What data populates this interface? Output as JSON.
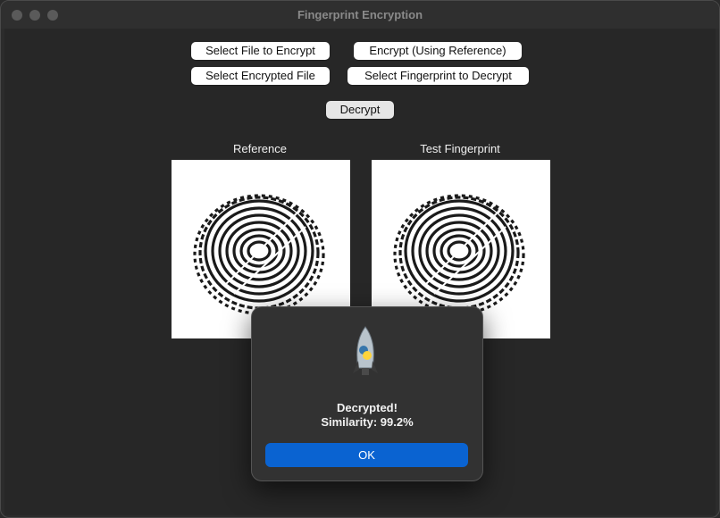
{
  "window": {
    "title": "Fingerprint Encryption"
  },
  "toolbar": {
    "select_file_label": "Select File to Encrypt",
    "encrypt_label": "Encrypt (Using Reference)",
    "select_encrypted_label": "Select Encrypted File",
    "select_fingerprint_label": "Select Fingerprint to Decrypt",
    "decrypt_label": "Decrypt"
  },
  "panels": {
    "reference_label": "Reference",
    "test_label": "Test Fingerprint"
  },
  "dialog": {
    "icon": "python-rocket-icon",
    "line1": "Decrypted!",
    "line2": "Similarity: 99.2%",
    "ok_label": "OK"
  },
  "colors": {
    "accent": "#0a63d1"
  }
}
